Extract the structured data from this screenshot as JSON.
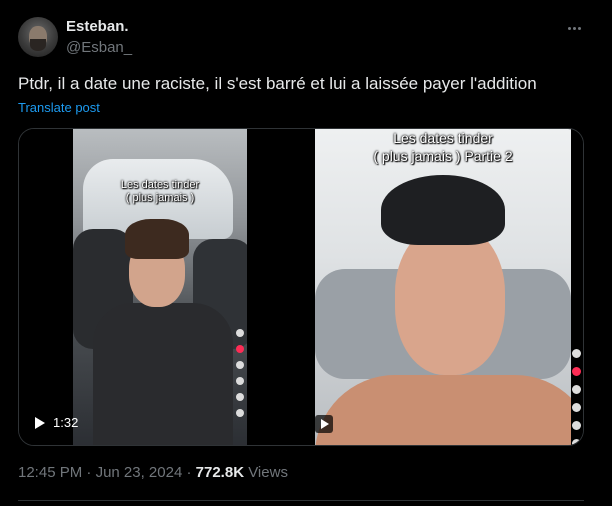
{
  "author": {
    "display_name": "Esteban.",
    "handle": "@Esban_"
  },
  "tweet": {
    "text": "Ptdr, il a date une raciste, il s'est barré et lui a laissée payer l'addition",
    "translate_label": "Translate post"
  },
  "media": {
    "video_left": {
      "overlay_text_line1": "Les dates tinder",
      "overlay_text_line2": "( plus jamais )",
      "duration": "1:32"
    },
    "video_right": {
      "overlay_text_line1": "Les dates tinder",
      "overlay_text_line2": "( plus jamais ) Partie 2"
    }
  },
  "meta": {
    "time": "12:45 PM",
    "sep1": " · ",
    "date": "Jun 23, 2024",
    "sep2": " · ",
    "views_count": "772.8K",
    "views_label": " Views"
  },
  "colors": {
    "background": "#000000",
    "text": "#e7e9ea",
    "muted": "#71767b",
    "link": "#1d9bf0",
    "border": "#2f3336"
  },
  "icons": {
    "more": "more-dots-icon",
    "play": "play-icon"
  }
}
